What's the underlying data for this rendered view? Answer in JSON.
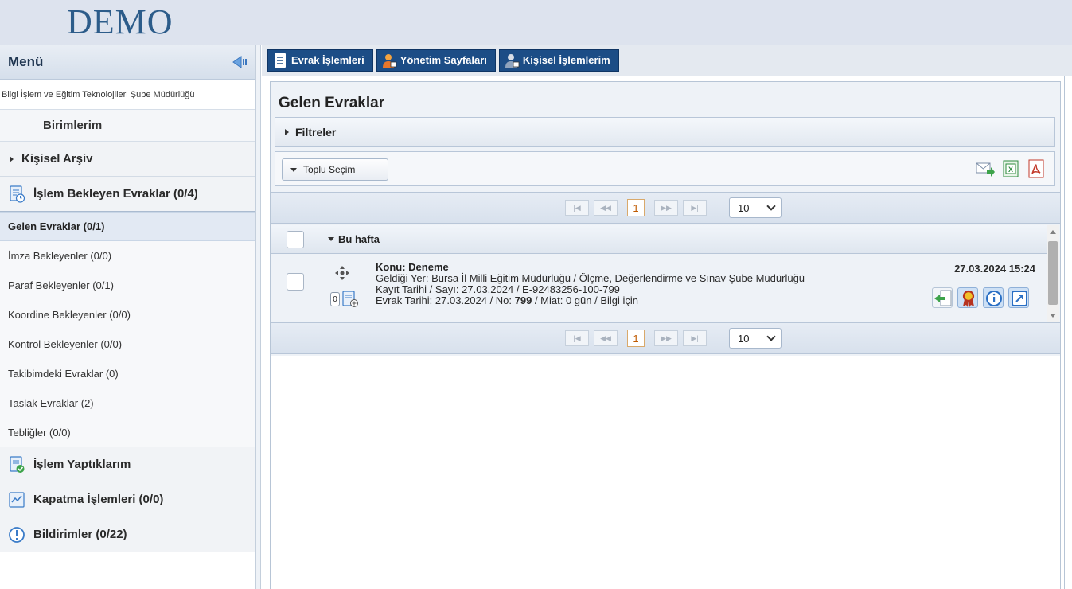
{
  "header": {
    "logo": "DEMO"
  },
  "sidebar": {
    "title": "Menü",
    "org_name": "Bilgi İşlem ve Eğitim Teknolojileri Şube Müdürlüğü",
    "birimlerim": "Birimlerim",
    "kisisel_arsiv": "Kişisel Arşiv",
    "islem_bekleyen": "İşlem Bekleyen Evraklar (0/4)",
    "sub_items": [
      "Gelen Evraklar (0/1)",
      "İmza Bekleyenler (0/0)",
      "Paraf Bekleyenler (0/1)",
      "Koordine Bekleyenler (0/0)",
      "Kontrol Bekleyenler (0/0)",
      "Takibimdeki Evraklar (0)",
      "Taslak Evraklar (2)",
      "Tebliğler (0/0)"
    ],
    "islem_yaptiklarim": "İşlem Yaptıklarım",
    "kapatma": "Kapatma İşlemleri (0/0)",
    "bildirimler": "Bildirimler (0/22)"
  },
  "top_tabs": [
    "Evrak İşlemleri",
    "Yönetim Sayfaları",
    "Kişisel İşlemlerim"
  ],
  "main": {
    "title": "Gelen Evraklar",
    "filters_label": "Filtreler",
    "toplu_secim": "Toplu Seçim",
    "pager": {
      "current_page": "1",
      "page_size": "10"
    },
    "group_label": "Bu hafta",
    "document": {
      "subject": "Konu: Deneme",
      "from": "Geldiği Yer: Bursa İl Milli Eğitim Müdürlüğü / Ölçme, Değerlendirme ve Sınav Şube Müdürlüğü",
      "kayit": "Kayıt Tarihi / Sayı: 27.03.2024 / E-92483256-100-799",
      "evrak_prefix": "Evrak Tarihi: 27.03.2024 / No: ",
      "evrak_no": "799",
      "evrak_suffix": " / Miat: 0 gün / Bilgi için",
      "datetime": "27.03.2024 15:24",
      "attachment_count": "0"
    }
  },
  "colors": {
    "tab_bg": "#1c4d86",
    "panel_bg": "#eef2f7",
    "page_accent": "#c05a00"
  }
}
